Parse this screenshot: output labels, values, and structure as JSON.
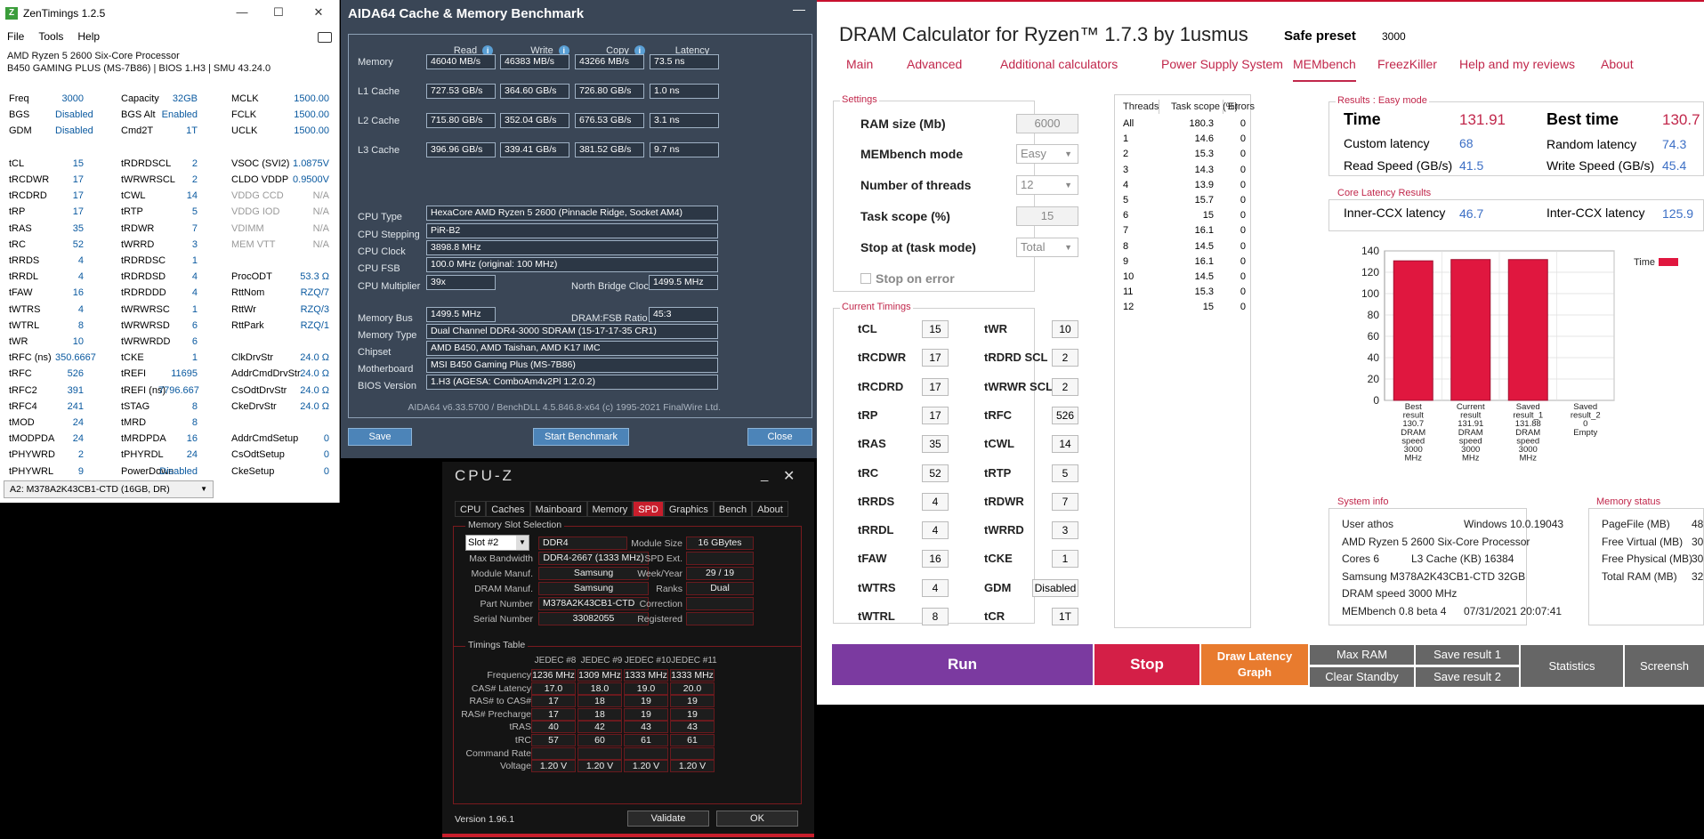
{
  "zen": {
    "title": "ZenTimings 1.2.5",
    "logo": "Z",
    "menu": [
      "File",
      "Tools",
      "Help"
    ],
    "cpu": "AMD Ryzen 5 2600 Six-Core Processor",
    "board": "B450 GAMING PLUS (MS-7B86) | BIOS 1.H3 | SMU 43.24.0",
    "rows": [
      [
        [
          "Freq",
          "3000"
        ],
        [
          "Capacity",
          "32GB"
        ],
        [
          "MCLK",
          "1500.00"
        ]
      ],
      [
        [
          "BGS",
          "Disabled"
        ],
        [
          "BGS Alt",
          "Enabled"
        ],
        [
          "FCLK",
          "1500.00"
        ]
      ],
      [
        [
          "GDM",
          "Disabled"
        ],
        [
          "Cmd2T",
          "1T"
        ],
        [
          "UCLK",
          "1500.00"
        ]
      ],
      [
        [
          "",
          ""
        ],
        [
          "",
          ""
        ],
        [
          "",
          ""
        ]
      ],
      [
        [
          "tCL",
          "15"
        ],
        [
          "tRDRDSCL",
          "2"
        ],
        [
          "VSOC (SVI2)",
          "1.0875V"
        ]
      ],
      [
        [
          "tRCDWR",
          "17"
        ],
        [
          "tWRWRSCL",
          "2"
        ],
        [
          "CLDO VDDP",
          "0.9500V"
        ]
      ],
      [
        [
          "tRCDRD",
          "17"
        ],
        [
          "tCWL",
          "14"
        ],
        [
          "VDDG CCD",
          "N/A"
        ]
      ],
      [
        [
          "tRP",
          "17"
        ],
        [
          "tRTP",
          "5"
        ],
        [
          "VDDG IOD",
          "N/A"
        ]
      ],
      [
        [
          "tRAS",
          "35"
        ],
        [
          "tRDWR",
          "7"
        ],
        [
          "VDIMM",
          "N/A"
        ]
      ],
      [
        [
          "tRC",
          "52"
        ],
        [
          "tWRRD",
          "3"
        ],
        [
          "MEM VTT",
          "N/A"
        ]
      ],
      [
        [
          "tRRDS",
          "4"
        ],
        [
          "tRDRDSC",
          "1"
        ],
        [
          "",
          ""
        ]
      ],
      [
        [
          "tRRDL",
          "4"
        ],
        [
          "tRDRDSD",
          "4"
        ],
        [
          "ProcODT",
          "53.3 Ω"
        ]
      ],
      [
        [
          "tFAW",
          "16"
        ],
        [
          "tRDRDDD",
          "4"
        ],
        [
          "RttNom",
          "RZQ/7"
        ]
      ],
      [
        [
          "tWTRS",
          "4"
        ],
        [
          "tWRWRSC",
          "1"
        ],
        [
          "RttWr",
          "RZQ/3"
        ]
      ],
      [
        [
          "tWTRL",
          "8"
        ],
        [
          "tWRWRSD",
          "6"
        ],
        [
          "RttPark",
          "RZQ/1"
        ]
      ],
      [
        [
          "tWR",
          "10"
        ],
        [
          "tWRWRDD",
          "6"
        ],
        [
          "",
          ""
        ]
      ],
      [
        [
          "tRFC (ns)",
          "350.6667"
        ],
        [
          "tCKE",
          "1"
        ],
        [
          "ClkDrvStr",
          "24.0 Ω"
        ]
      ],
      [
        [
          "tRFC",
          "526"
        ],
        [
          "tREFI",
          "11695"
        ],
        [
          "AddrCmdDrvStr",
          "24.0 Ω"
        ]
      ],
      [
        [
          "tRFC2",
          "391"
        ],
        [
          "tREFI (ns)",
          "7796.667"
        ],
        [
          "CsOdtDrvStr",
          "24.0 Ω"
        ]
      ],
      [
        [
          "tRFC4",
          "241"
        ],
        [
          "tSTAG",
          "8"
        ],
        [
          "CkeDrvStr",
          "24.0 Ω"
        ]
      ],
      [
        [
          "tMOD",
          "24"
        ],
        [
          "tMRD",
          "8"
        ],
        [
          "",
          ""
        ]
      ],
      [
        [
          "tMODPDA",
          "24"
        ],
        [
          "tMRDPDA",
          "16"
        ],
        [
          "AddrCmdSetup",
          "0"
        ]
      ],
      [
        [
          "tPHYWRD",
          "2"
        ],
        [
          "tPHYRDL",
          "24"
        ],
        [
          "CsOdtSetup",
          "0"
        ]
      ],
      [
        [
          "tPHYWRL",
          "9"
        ],
        [
          "PowerDown",
          "Disabled"
        ],
        [
          "CkeSetup",
          "0"
        ]
      ]
    ],
    "module": "A2: M378A2K43CB1-CTD (16GB, DR)"
  },
  "aida": {
    "title": "AIDA64 Cache & Memory Benchmark",
    "headers": [
      "Read",
      "Write",
      "Copy",
      "Latency"
    ],
    "bench": [
      {
        "label": "Memory",
        "vals": [
          "46040 MB/s",
          "46383 MB/s",
          "43266 MB/s",
          "73.5 ns"
        ]
      },
      {
        "label": "L1 Cache",
        "vals": [
          "727.53 GB/s",
          "364.60 GB/s",
          "726.80 GB/s",
          "1.0 ns"
        ]
      },
      {
        "label": "L2 Cache",
        "vals": [
          "715.80 GB/s",
          "352.04 GB/s",
          "676.53 GB/s",
          "3.1 ns"
        ]
      },
      {
        "label": "L3 Cache",
        "vals": [
          "396.96 GB/s",
          "339.41 GB/s",
          "381.52 GB/s",
          "9.7 ns"
        ]
      }
    ],
    "cpu_type_label": "CPU Type",
    "cpu_type": "HexaCore AMD Ryzen 5 2600  (Pinnacle Ridge, Socket AM4)",
    "cpu_step_label": "CPU Stepping",
    "cpu_step": "PiR-B2",
    "cpu_clock_label": "CPU Clock",
    "cpu_clock": "3898.8 MHz",
    "cpu_fsb_label": "CPU FSB",
    "cpu_fsb": "100.0 MHz  (original: 100 MHz)",
    "cpu_mult_label": "CPU Multiplier",
    "cpu_mult": "39x",
    "nb_label": "North Bridge Clock",
    "nb": "1499.5 MHz",
    "mem_bus_label": "Memory Bus",
    "mem_bus": "1499.5 MHz",
    "ratio_label": "DRAM:FSB Ratio",
    "ratio": "45:3",
    "mem_type_label": "Memory Type",
    "mem_type": "Dual Channel DDR4-3000 SDRAM  (15-17-17-35 CR1)",
    "chipset_label": "Chipset",
    "chipset": "AMD B450, AMD Taishan, AMD K17 IMC",
    "mobo_label": "Motherboard",
    "mobo": "MSI B450 Gaming Plus (MS-7B86)",
    "bios_label": "BIOS Version",
    "bios": "1.H3  (AGESA: ComboAm4v2Pl 1.2.0.2)",
    "footer": "AIDA64 v6.33.5700 / BenchDLL 4.5.846.8-x64  (c) 1995-2021 FinalWire Ltd.",
    "save": "Save",
    "start": "Start Benchmark",
    "close": "Close"
  },
  "cpuz": {
    "title": "CPU-Z",
    "tabs": [
      "CPU",
      "Caches",
      "Mainboard",
      "Memory",
      "SPD",
      "Graphics",
      "Bench",
      "About"
    ],
    "slot_legend": "Memory Slot Selection",
    "slot": "Slot #2",
    "ddr": "DDR4",
    "module_size_label": "Module Size",
    "module_size": "16 GBytes",
    "maxbw_label": "Max Bandwidth",
    "maxbw": "DDR4-2667 (1333 MHz)",
    "spdext_label": "SPD Ext.",
    "manuf_label": "Module Manuf.",
    "manuf": "Samsung",
    "week_label": "Week/Year",
    "week": "29 / 19",
    "dram_label": "DRAM Manuf.",
    "dram": "Samsung",
    "ranks_label": "Ranks",
    "ranks": "Dual",
    "part_label": "Part Number",
    "part": "M378A2K43CB1-CTD",
    "corr_label": "Correction",
    "serial_label": "Serial Number",
    "serial": "33082055",
    "reg_label": "Registered",
    "timings_legend": "Timings Table",
    "jedec": [
      "JEDEC #8",
      "JEDEC #9",
      "JEDEC #10",
      "JEDEC #11"
    ],
    "trows": [
      {
        "label": "Frequency",
        "vals": [
          "1236 MHz",
          "1309 MHz",
          "1333 MHz",
          "1333 MHz"
        ]
      },
      {
        "label": "CAS# Latency",
        "vals": [
          "17.0",
          "18.0",
          "19.0",
          "20.0"
        ]
      },
      {
        "label": "RAS# to CAS#",
        "vals": [
          "17",
          "18",
          "19",
          "19"
        ]
      },
      {
        "label": "RAS# Precharge",
        "vals": [
          "17",
          "18",
          "19",
          "19"
        ]
      },
      {
        "label": "tRAS",
        "vals": [
          "40",
          "42",
          "43",
          "43"
        ]
      },
      {
        "label": "tRC",
        "vals": [
          "57",
          "60",
          "61",
          "61"
        ]
      },
      {
        "label": "Command Rate",
        "vals": [
          "",
          "",
          "",
          ""
        ]
      },
      {
        "label": "Voltage",
        "vals": [
          "1.20 V",
          "1.20 V",
          "1.20 V",
          "1.20 V"
        ]
      }
    ],
    "version": "Version 1.96.1",
    "validate": "Validate",
    "ok": "OK"
  },
  "dram": {
    "title": "DRAM Calculator for Ryzen™ 1.7.3 by 1usmus",
    "preset_label": "Safe preset",
    "preset": "3000",
    "tabs": [
      "Main",
      "Advanced",
      "Additional calculators",
      "Power Supply System",
      "MEMbench",
      "FreezKiller",
      "Help and my reviews",
      "About"
    ],
    "settings_legend": "Settings",
    "ram_label": "RAM size (Mb)",
    "ram": "6000",
    "mode_label": "MEMbench mode",
    "mode": "Easy",
    "threads_label": "Number of threads",
    "threads": "12",
    "scope_label": "Task scope (%)",
    "scope": "15",
    "stop_label": "Stop at (task mode)",
    "stop": "Total",
    "stop_err": "Stop on error",
    "timings_legend": "Current Timings",
    "timings": [
      [
        "tCL",
        "15",
        "tWR",
        "10"
      ],
      [
        "tRCDWR",
        "17",
        "tRDRD SCL",
        "2"
      ],
      [
        "tRCDRD",
        "17",
        "tWRWR SCL",
        "2"
      ],
      [
        "tRP",
        "17",
        "tRFC",
        "526"
      ],
      [
        "tRAS",
        "35",
        "tCWL",
        "14"
      ],
      [
        "tRC",
        "52",
        "tRTP",
        "5"
      ],
      [
        "tRRDS",
        "4",
        "tRDWR",
        "7"
      ],
      [
        "tRRDL",
        "4",
        "tWRRD",
        "3"
      ],
      [
        "tFAW",
        "16",
        "tCKE",
        "1"
      ],
      [
        "tWTRS",
        "4",
        "GDM",
        "Disabled"
      ],
      [
        "tWTRL",
        "8",
        "tCR",
        "1T"
      ]
    ],
    "thr_headers": [
      "Threads",
      "Task scope (%)",
      "Errors"
    ],
    "thr_rows": [
      [
        "All",
        "180.3",
        "0"
      ],
      [
        "1",
        "14.6",
        "0"
      ],
      [
        "2",
        "15.3",
        "0"
      ],
      [
        "3",
        "14.3",
        "0"
      ],
      [
        "4",
        "13.9",
        "0"
      ],
      [
        "5",
        "15.7",
        "0"
      ],
      [
        "6",
        "15",
        "0"
      ],
      [
        "7",
        "16.1",
        "0"
      ],
      [
        "8",
        "14.5",
        "0"
      ],
      [
        "9",
        "16.1",
        "0"
      ],
      [
        "10",
        "14.5",
        "0"
      ],
      [
        "11",
        "15.3",
        "0"
      ],
      [
        "12",
        "15",
        "0"
      ]
    ],
    "results_legend": "Results : Easy mode",
    "time_label": "Time",
    "time": "131.91",
    "best_label": "Best time",
    "best": "130.7",
    "custom_label": "Custom latency",
    "custom": "68",
    "random_label": "Random latency",
    "random": "74.3",
    "read_label": "Read Speed (GB/s)",
    "read": "41.5",
    "write_label": "Write Speed (GB/s)",
    "write": "45.4",
    "core_legend": "Core Latency Results",
    "inner_label": "Inner-CCX latency",
    "inner": "46.7",
    "inter_label": "Inter-CCX latency",
    "inter": "125.9",
    "sysinfo_legend": "System info",
    "sysinfo": [
      [
        "User athos",
        "Windows 10.0.19043"
      ],
      [
        "AMD Ryzen 5 2600 Six-Core Processor",
        ""
      ],
      [
        "Cores 6",
        "L3 Cache (KB)     16384"
      ],
      [
        "Samsung M378A2K43CB1-CTD   32GB",
        ""
      ],
      [
        "DRAM speed 3000 MHz",
        ""
      ],
      [
        "MEMbench 0.8 beta 4",
        "07/31/2021 20:07:41"
      ]
    ],
    "memstat_legend": "Memory status",
    "memstat": [
      [
        "PageFile (MB)",
        "48"
      ],
      [
        "Free Virtual (MB)",
        "30"
      ],
      [
        "Free Physical (MB)",
        "30"
      ],
      [
        "Total RAM (MB)",
        "32"
      ]
    ],
    "run": "Run",
    "stopbtn": "Stop",
    "draw": "Draw Latency Graph",
    "maxram": "Max RAM",
    "clear": "Clear Standby",
    "save1": "Save result 1",
    "save2": "Save result 2",
    "stats": "Statistics",
    "shot": "Screensh"
  },
  "chart_data": {
    "type": "bar",
    "categories": [
      "Best result 130.7 DRAM speed 3000 MHz",
      "Current result 131.91 DRAM speed 3000 MHz",
      "Saved result_1 131.88 DRAM speed 3000 MHz",
      "Saved result_2 0 Empty"
    ],
    "cat_lines": [
      [
        "Best",
        "result",
        "130.7",
        "DRAM",
        "speed",
        "3000",
        "MHz"
      ],
      [
        "Current",
        "result",
        "131.91",
        "DRAM",
        "speed",
        "3000",
        "MHz"
      ],
      [
        "Saved",
        "result_1",
        "131.88",
        "DRAM",
        "speed",
        "3000",
        "MHz"
      ],
      [
        "Saved",
        "result_2",
        "0",
        "Empty"
      ]
    ],
    "series": [
      {
        "name": "Time",
        "values": [
          130.7,
          131.91,
          131.88,
          0
        ]
      }
    ],
    "yticks": [
      "140",
      "120",
      "100",
      "80",
      "60",
      "40",
      "20",
      "0"
    ],
    "ylim": [
      0,
      140
    ],
    "legend": "top-right",
    "color": "#e0173f"
  }
}
